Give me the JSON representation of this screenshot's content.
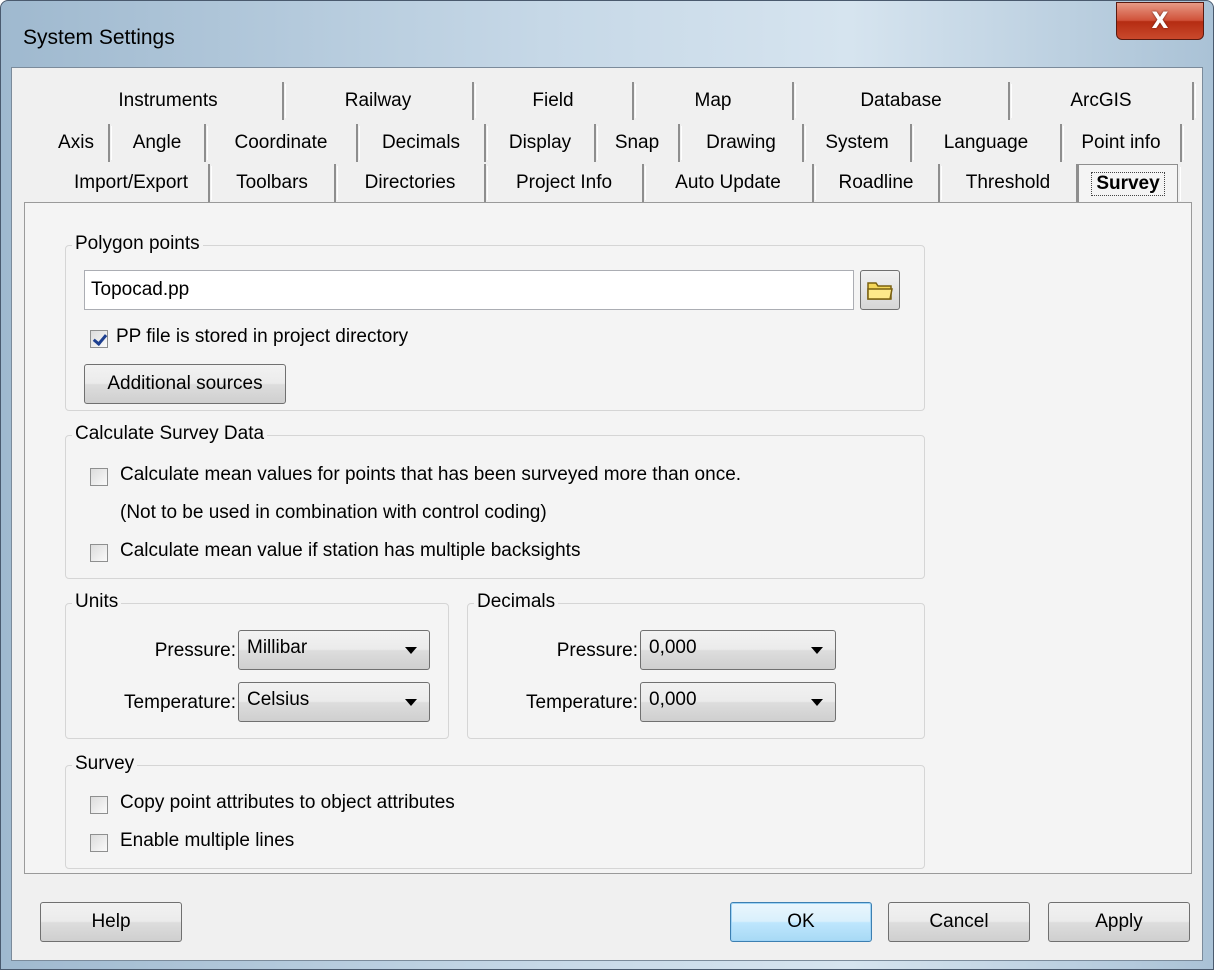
{
  "window": {
    "title": "System Settings",
    "close_glyph": "X"
  },
  "tabs": {
    "row1": [
      "Instruments",
      "Railway",
      "Field",
      "Map",
      "Database",
      "ArcGIS"
    ],
    "row2": [
      "Axis",
      "Angle",
      "Coordinate",
      "Decimals",
      "Display",
      "Snap",
      "Drawing",
      "System",
      "Language",
      "Point info"
    ],
    "row3": [
      "Import/Export",
      "Toolbars",
      "Directories",
      "Project Info",
      "Auto Update",
      "Roadline",
      "Threshold",
      "Survey"
    ],
    "selected": "Survey"
  },
  "polygon": {
    "title": "Polygon points",
    "file_value": "Topocad.pp",
    "folder_icon": "folder-icon",
    "pp_checkbox_label": "PP file is stored in project directory",
    "pp_checked": true,
    "additional_button": "Additional sources"
  },
  "calc": {
    "title": "Calculate Survey Data",
    "mean_label": "Calculate mean values for points that has been surveyed more than once.",
    "mean_note": "(Not to be used in combination with control coding)",
    "station_label": "Calculate mean value if station has multiple backsights",
    "mean_checked": false,
    "station_checked": false
  },
  "units": {
    "title": "Units",
    "pressure_label": "Pressure:",
    "pressure_value": "Millibar",
    "temperature_label": "Temperature:",
    "temperature_value": "Celsius"
  },
  "decimals": {
    "title": "Decimals",
    "pressure_label": "Pressure:",
    "pressure_value": "0,000",
    "temperature_label": "Temperature:",
    "temperature_value": "0,000"
  },
  "survey": {
    "title": "Survey",
    "copy_label": "Copy point attributes to object attributes",
    "multi_label": "Enable multiple lines",
    "copy_checked": false,
    "multi_checked": false
  },
  "buttons": {
    "help": "Help",
    "ok": "OK",
    "cancel": "Cancel",
    "apply": "Apply"
  }
}
